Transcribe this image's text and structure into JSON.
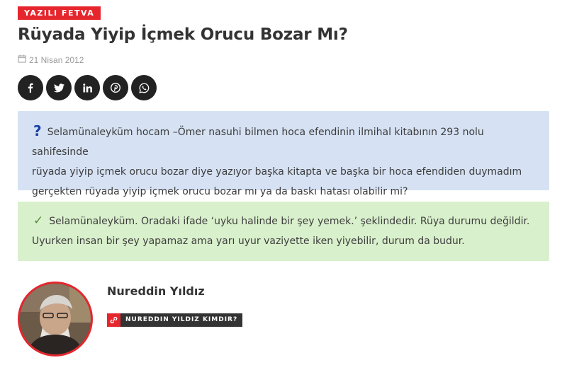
{
  "category": {
    "label": "YAZILI FETVA",
    "color": "#e5262d"
  },
  "article": {
    "title": "Rüyada Yiyip İçmek Orucu Bozar Mı?",
    "date": "21 Nisan 2012"
  },
  "share": {
    "buttons": [
      {
        "icon": "facebook-icon"
      },
      {
        "icon": "twitter-icon"
      },
      {
        "icon": "linkedin-icon"
      },
      {
        "icon": "pinterest-icon"
      },
      {
        "icon": "whatsapp-icon"
      }
    ]
  },
  "question": {
    "mark": "?",
    "lines": [
      "Selamünaleyküm hocam –Ömer nasuhi bilmen hoca efendinin ilmihal kitabının 293 nolu sahifesinde",
      "rüyada yiyip içmek orucu bozar diye yazıyor başka kitapta ve başka bir hoca efendiden duymadım",
      "gerçekten rüyada yiyip içmek orucu bozar mı ya da baskı hatası olabilir mi?"
    ],
    "background": "#d6e2f3"
  },
  "answer": {
    "mark": "✓",
    "lines": [
      "Selamünaleyküm. Oradaki ifade ‘uyku halinde bir şey yemek.’ şeklindedir. Rüya durumu değildir.",
      "Uyurken insan bir şey yapamaz ama yarı uyur vaziyette iken yiyebilir, durum da budur."
    ],
    "background": "#d9f0cc"
  },
  "author": {
    "name": "Nureddin Yıldız",
    "link_label": "NUREDDIN YILDIZ KIMDIR?"
  }
}
